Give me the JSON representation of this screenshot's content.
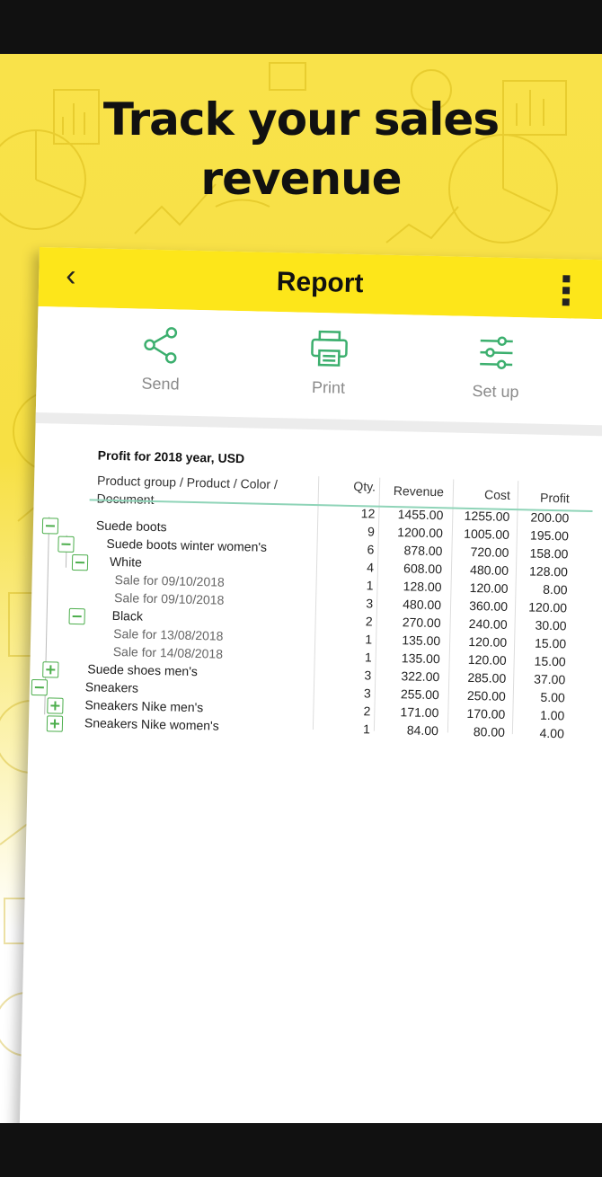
{
  "headline": {
    "line1": "Track your sales",
    "line2": "revenue"
  },
  "appbar": {
    "back_glyph": "‹",
    "title": "Report"
  },
  "actions": [
    {
      "label": "Send",
      "icon": "share-icon"
    },
    {
      "label": "Print",
      "icon": "printer-icon"
    },
    {
      "label": "Set up",
      "icon": "sliders-icon"
    }
  ],
  "colors": {
    "accent_yellow": "#fde61a",
    "icon_green": "#3caf6e",
    "tree_green": "#4cae4c"
  },
  "report": {
    "title": "Profit for 2018 year, USD",
    "headers": {
      "name_line1": "Product group / Product / Color /",
      "name_line2": "Document",
      "qty": "Qty.",
      "revenue": "Revenue",
      "cost": "Cost",
      "profit": "Profit"
    },
    "rows": [
      {
        "name": "",
        "qty": "12",
        "revenue": "1455.00",
        "cost": "1255.00",
        "profit": "200.00",
        "toggle": ""
      },
      {
        "name": "Suede boots",
        "qty": "9",
        "revenue": "1200.00",
        "cost": "1005.00",
        "profit": "195.00",
        "toggle": "minus"
      },
      {
        "name": "Suede boots winter women's",
        "qty": "6",
        "revenue": "878.00",
        "cost": "720.00",
        "profit": "158.00",
        "toggle": "minus"
      },
      {
        "name": "White",
        "qty": "4",
        "revenue": "608.00",
        "cost": "480.00",
        "profit": "128.00",
        "toggle": "minus"
      },
      {
        "name": "Sale for 09/10/2018",
        "qty": "1",
        "revenue": "128.00",
        "cost": "120.00",
        "profit": "8.00",
        "toggle": ""
      },
      {
        "name": "Sale for 09/10/2018",
        "qty": "3",
        "revenue": "480.00",
        "cost": "360.00",
        "profit": "120.00",
        "toggle": ""
      },
      {
        "name": "Black",
        "qty": "2",
        "revenue": "270.00",
        "cost": "240.00",
        "profit": "30.00",
        "toggle": "minus"
      },
      {
        "name": "Sale for 13/08/2018",
        "qty": "1",
        "revenue": "135.00",
        "cost": "120.00",
        "profit": "15.00",
        "toggle": ""
      },
      {
        "name": "Sale for 14/08/2018",
        "qty": "1",
        "revenue": "135.00",
        "cost": "120.00",
        "profit": "15.00",
        "toggle": ""
      },
      {
        "name": "Suede shoes men's",
        "qty": "3",
        "revenue": "322.00",
        "cost": "285.00",
        "profit": "37.00",
        "toggle": "plus"
      },
      {
        "name": "Sneakers",
        "qty": "3",
        "revenue": "255.00",
        "cost": "250.00",
        "profit": "5.00",
        "toggle": "minus"
      },
      {
        "name": "Sneakers Nike men's",
        "qty": "2",
        "revenue": "171.00",
        "cost": "170.00",
        "profit": "1.00",
        "toggle": "plus"
      },
      {
        "name": "Sneakers Nike women's",
        "qty": "1",
        "revenue": "84.00",
        "cost": "80.00",
        "profit": "4.00",
        "toggle": "plus"
      }
    ]
  }
}
